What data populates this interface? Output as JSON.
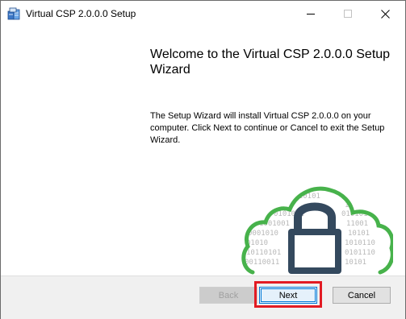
{
  "window": {
    "title": "Virtual CSP 2.0.0.0 Setup",
    "controls": {
      "minimize": "minimize-icon",
      "maximize": "maximize-icon",
      "close": "close-icon"
    }
  },
  "main": {
    "heading": "Welcome to the Virtual CSP 2.0.0.0 Setup Wizard",
    "description": "The Setup Wizard will install Virtual CSP 2.0.0.0 on your computer. Click Next to continue or Cancel to exit the Setup Wizard."
  },
  "illustration": {
    "icon": "cloud-lock-icon",
    "binary_lines": [
      "1010101",
      "10101",
      "0101011",
      "010101",
      "1001001",
      "11001",
      "0001010",
      "10101",
      "01010",
      "1010110",
      "10110101",
      "0101110",
      "00110011",
      "10101"
    ],
    "colors": {
      "cloud": "#47b24b",
      "lock": "#34495e",
      "digits": "#b9b9b9"
    }
  },
  "footer": {
    "back_label": "Back",
    "next_label": "Next",
    "cancel_label": "Cancel",
    "highlight_color": "#e21b23"
  }
}
